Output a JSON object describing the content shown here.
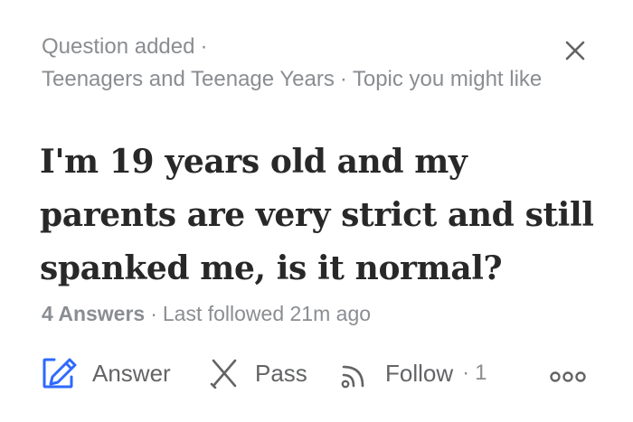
{
  "meta": {
    "event": "Question added",
    "separator": "·",
    "topic": "Teenagers and Teenage Years",
    "topic_note": "Topic you might like"
  },
  "icons": {
    "close": "close-icon",
    "answer": "pencil-icon",
    "pass": "pass-icon",
    "follow": "rss-icon",
    "more": "more-icon"
  },
  "question": {
    "title": "I'm 19 years old and my parents are very strict and still spanked me, is it normal?"
  },
  "stats": {
    "answers": "4 Answers",
    "separator": "·",
    "last_followed": "Last followed 21m ago"
  },
  "actions": {
    "answer_label": "Answer",
    "pass_label": "Pass",
    "follow_label": "Follow",
    "separator": "·",
    "follow_count": "1"
  },
  "colors": {
    "accent": "#2e69ff",
    "muted_text": "#8a8d91",
    "action_text": "#636466",
    "title_text": "#282829",
    "background": "#ffffff"
  }
}
